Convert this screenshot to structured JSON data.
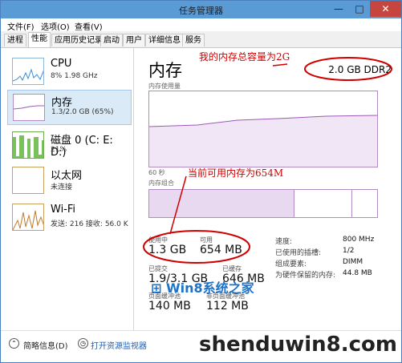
{
  "window": {
    "title": "任务管理器",
    "minimize": "—",
    "maximize": "□",
    "close": "✕"
  },
  "menu": [
    "文件(F)",
    "选项(O)",
    "查看(V)"
  ],
  "tabs": [
    "进程",
    "性能",
    "应用历史记录",
    "启动",
    "用户",
    "详细信息",
    "服务"
  ],
  "active_tab": 1,
  "sidebar": [
    {
      "name": "CPU",
      "sub": "8% 1.98 GHz"
    },
    {
      "name": "内存",
      "sub": "1.3/2.0 GB (65%)"
    },
    {
      "name": "磁盘 0 (C: E: D:)",
      "sub": "21%"
    },
    {
      "name": "以太网",
      "sub": "未连接"
    },
    {
      "name": "Wi-Fi",
      "sub": "发送: 216 接收: 56.0 K"
    }
  ],
  "main": {
    "title": "内存",
    "capacity": "2.0 GB DDR2",
    "usage_label": "内存使用量",
    "axis_left": "60 秒",
    "composition_label": "内存组合",
    "in_use_label": "使用中",
    "in_use": "1.3 GB",
    "available_label": "可用",
    "available": "654 MB",
    "committed_label": "已提交",
    "committed": "1.9/3.1 GB",
    "cached_label": "已缓存",
    "cached": "646 MB",
    "paged_label": "页面缓冲池",
    "paged": "140 MB",
    "nonpaged_label": "非页面缓冲池",
    "nonpaged": "112 MB",
    "details": [
      {
        "k": "速度:",
        "v": "800 MHz"
      },
      {
        "k": "已使用的插槽:",
        "v": "1/2"
      },
      {
        "k": "组成要素:",
        "v": "DIMM"
      },
      {
        "k": "为硬件保留的内存:",
        "v": "44.8 MB"
      }
    ]
  },
  "bottom": {
    "less": "简略信息(D)",
    "monitor": "打开资源监视器"
  },
  "annotations": {
    "a1": "我的内存总容量为2G",
    "a2": "当前可用内存为654M"
  },
  "watermark": "shenduwin8.com",
  "logo_text": "Win8系统之家",
  "colors": {
    "accent": "#5b9bd5",
    "memory": "#9b59b6",
    "annotation": "#d00000"
  }
}
